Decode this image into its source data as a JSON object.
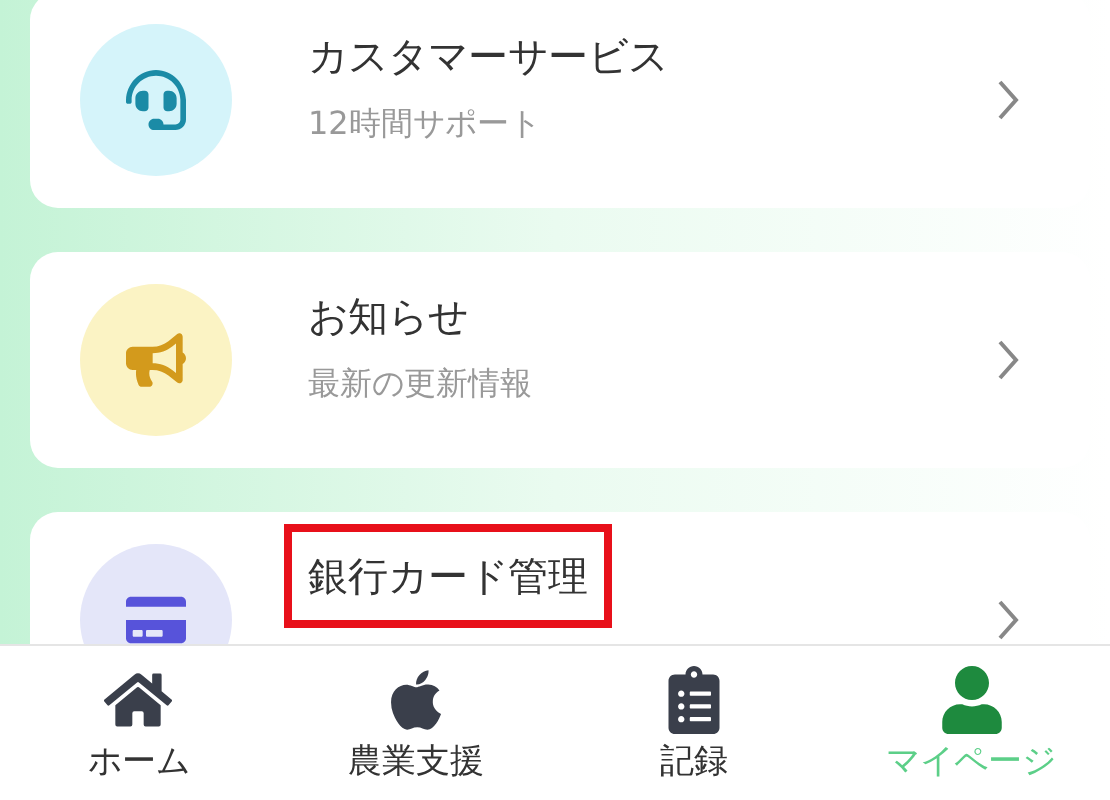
{
  "menu_items": [
    {
      "title": "カスタマーサービス",
      "subtitle": "12時間サポート",
      "highlighted": false
    },
    {
      "title": "お知らせ",
      "subtitle": "最新の更新情報",
      "highlighted": false
    },
    {
      "title": "銀行カード管理",
      "highlighted": true
    }
  ],
  "bottom_nav": [
    {
      "label": "ホーム",
      "selected": false
    },
    {
      "label": "農業支援",
      "selected": false
    },
    {
      "label": "記録",
      "selected": false
    },
    {
      "label": "マイページ",
      "selected": true
    }
  ]
}
